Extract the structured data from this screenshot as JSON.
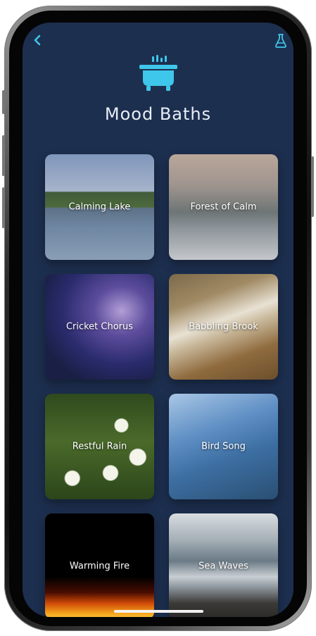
{
  "app": {
    "title": "Mood Baths"
  },
  "header": {
    "back_icon": "chevron-left-icon",
    "lab_icon": "flask-icon",
    "hero_icon": "bathtub-icon"
  },
  "colors": {
    "screen_background": "#1d2f4f",
    "accent": "#3ec7ea",
    "title_text": "#e8eef6"
  },
  "tiles": [
    {
      "label": "Calming Lake"
    },
    {
      "label": "Forest of Calm"
    },
    {
      "label": "Cricket Chorus"
    },
    {
      "label": "Babbling Brook"
    },
    {
      "label": "Restful Rain"
    },
    {
      "label": "Bird Song"
    },
    {
      "label": "Warming Fire"
    },
    {
      "label": "Sea Waves"
    }
  ]
}
